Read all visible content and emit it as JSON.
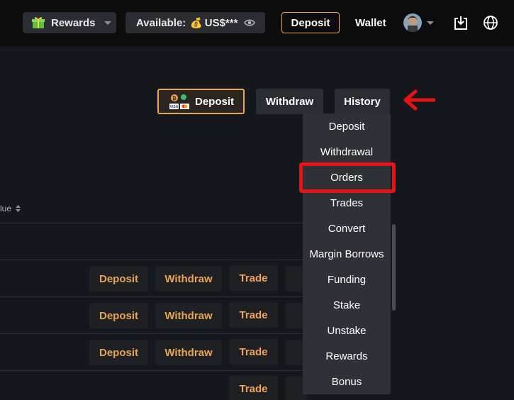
{
  "topbar": {
    "rewards_label": "Rewards",
    "available_label": "Available:",
    "available_value": "US$***",
    "deposit_label": "Deposit",
    "wallet_label": "Wallet"
  },
  "actions": {
    "deposit_label": "Deposit",
    "withdraw_label": "Withdraw",
    "history_label": "History"
  },
  "table": {
    "column_header": "lue",
    "rows": [
      {
        "deposit": "Deposit",
        "withdraw": "Withdraw",
        "trade": "Trade"
      },
      {
        "deposit": "Deposit",
        "withdraw": "Withdraw",
        "trade": "Trade"
      },
      {
        "deposit": "Deposit",
        "withdraw": "Withdraw",
        "trade": "Trade"
      },
      {
        "trade": "Trade"
      }
    ]
  },
  "history_menu": {
    "items": [
      "Deposit",
      "Withdrawal",
      "Orders",
      "Trades",
      "Convert",
      "Margin Borrows",
      "Funding",
      "Stake",
      "Unstake",
      "Rewards",
      "Bonus"
    ],
    "highlighted": "Orders"
  },
  "colors": {
    "accent": "#e8a552",
    "annotation_red": "#e41414",
    "background": "#16171c",
    "topbar": "#0c0c0d"
  },
  "icons": [
    "gift-icon",
    "money-bag-icon",
    "eye-icon",
    "avatar",
    "download-icon",
    "globe-icon",
    "payment-cards-icon",
    "red-arrow-annotation",
    "sort-icon"
  ]
}
